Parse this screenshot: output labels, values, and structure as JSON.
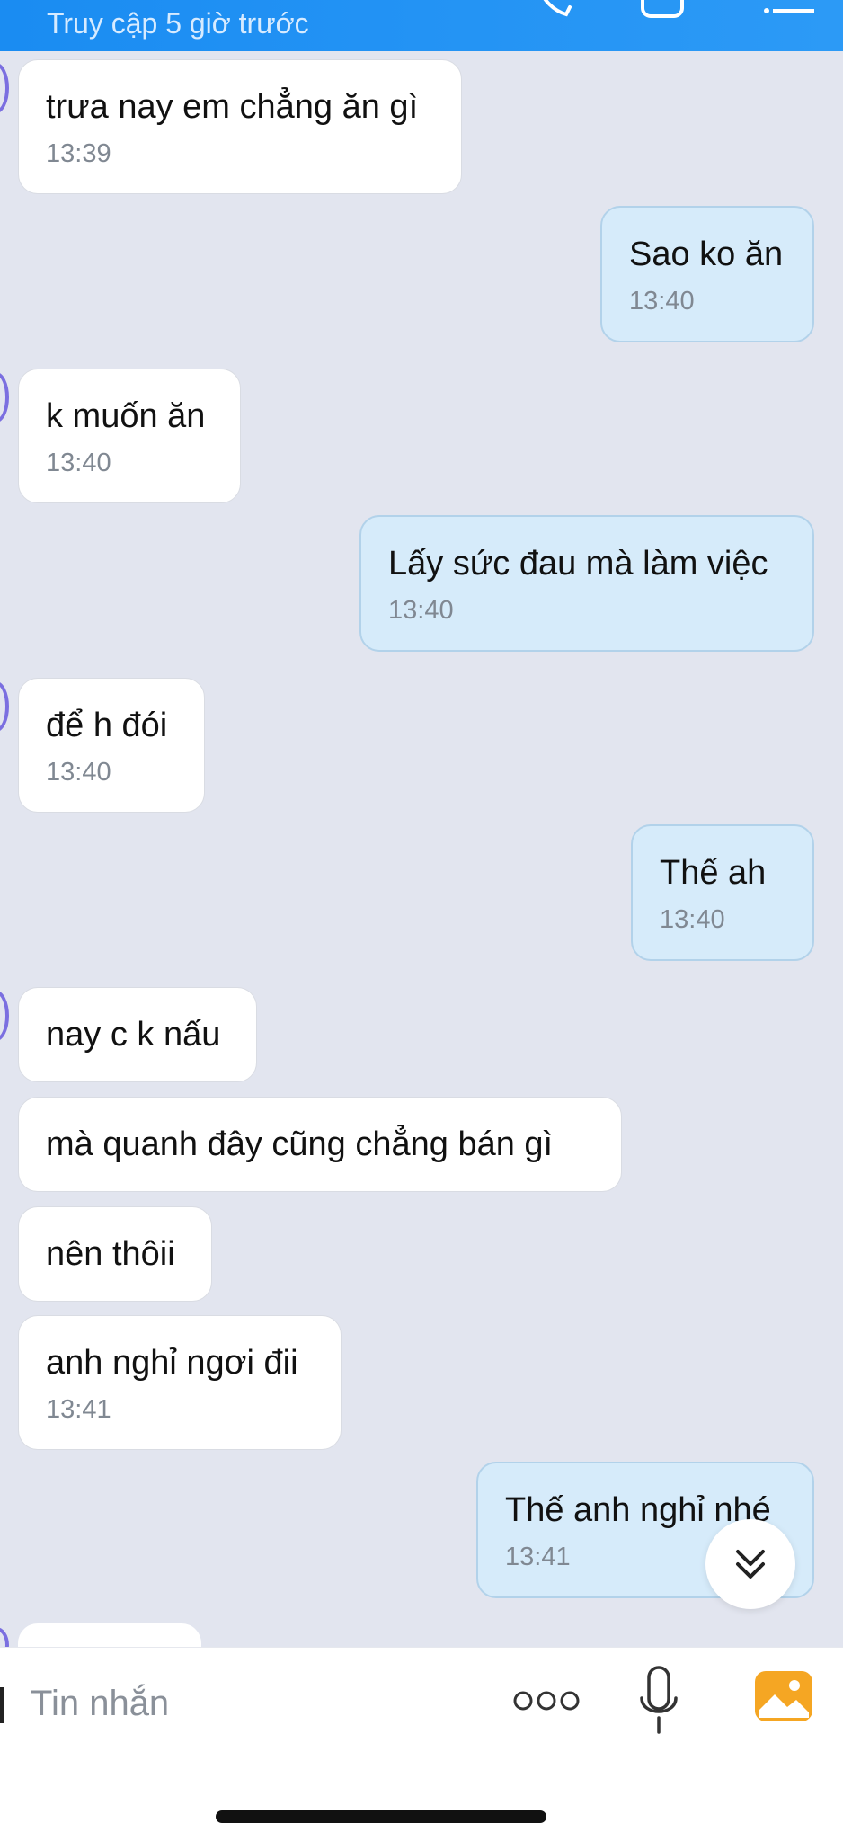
{
  "header": {
    "status": "Truy cập 5 giờ trước"
  },
  "messages": [
    {
      "text": "trưa nay em chẳng ăn gì",
      "time": "13:39"
    },
    {
      "text": "Sao ko ăn",
      "time": "13:40"
    },
    {
      "text": "k muốn ăn",
      "time": "13:40"
    },
    {
      "text": "Lấy sức đau mà làm việc",
      "time": "13:40"
    },
    {
      "text": "để h đói",
      "time": "13:40"
    },
    {
      "text": "Thế ah",
      "time": "13:40"
    },
    {
      "text": "nay c k nấu"
    },
    {
      "text": "mà quanh đây cũng chẳng bán  gì"
    },
    {
      "text": "nên thôii"
    },
    {
      "text": "anh nghỉ ngơi đii",
      "time": "13:41"
    },
    {
      "text": "Thế anh nghỉ nhé",
      "time": "13:41"
    }
  ],
  "input": {
    "placeholder": "Tin nhắn"
  },
  "icons": {
    "header": [
      "phone-icon",
      "video-call-icon",
      "menu-icon"
    ],
    "input": [
      "more-options-icon",
      "microphone-icon",
      "gallery-icon"
    ],
    "scroll": "double-chevron-down-icon"
  },
  "colors": {
    "header": "#1a8cf2",
    "incoming_bubble": "#ffffff",
    "outgoing_bubble": "#d6ebfa",
    "background": "#e2e5ef",
    "gallery_icon": "#f5a623"
  }
}
